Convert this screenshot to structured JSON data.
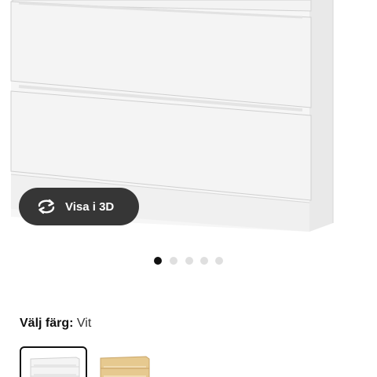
{
  "product_gallery": {
    "view_3d_label": "Visa i 3D",
    "view_3d_icon": "rotate-3d-icon",
    "image_count": 5,
    "active_image_index": 0
  },
  "color_selector": {
    "heading": "Välj färg:",
    "selected_value": "Vit",
    "swatches": [
      {
        "name": "white",
        "selected": true,
        "color": "#f4f4f4"
      },
      {
        "name": "oak",
        "selected": false,
        "color": "#e6c98f"
      }
    ]
  },
  "colors": {
    "dot_active": "#111111",
    "dot_inactive": "#dfdfdf",
    "button_bg": "#363636"
  }
}
